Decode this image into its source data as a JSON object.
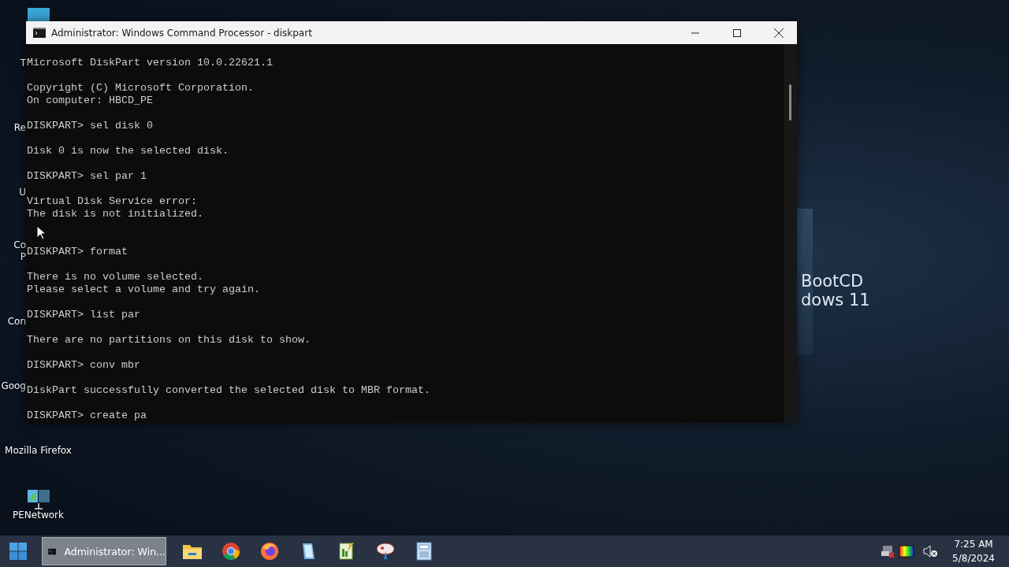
{
  "desktop": {
    "icons": [
      {
        "labels": [
          "T"
        ],
        "kind": "hidden"
      },
      {
        "labels": [
          "Re"
        ],
        "kind": "hidden"
      },
      {
        "labels": [
          "U"
        ],
        "kind": "hidden"
      },
      {
        "labels": [
          "Co",
          "P"
        ],
        "kind": "hidden"
      },
      {
        "labels": [
          "Con"
        ],
        "kind": "hidden"
      },
      {
        "labels": [
          "Goog"
        ],
        "kind": "hidden"
      },
      {
        "labels": [
          "Mozilla Firefox"
        ],
        "kind": "plain"
      },
      {
        "labels": [
          "PENetwork"
        ],
        "kind": "network"
      }
    ],
    "wallpaper_text": [
      "BootCD",
      "dows 11"
    ]
  },
  "window": {
    "title": "Administrator: Windows Command Processor - diskpart",
    "console": [
      {
        "lines": [
          "Microsoft DiskPart version 10.0.22621.1"
        ]
      },
      {
        "lines": [
          "Copyright (C) Microsoft Corporation.",
          "On computer: HBCD_PE"
        ]
      },
      {
        "lines": [
          "DISKPART> sel disk 0"
        ]
      },
      {
        "lines": [
          "Disk 0 is now the selected disk."
        ]
      },
      {
        "lines": [
          "DISKPART> sel par 1"
        ]
      },
      {
        "lines": [
          "Virtual Disk Service error:",
          "The disk is not initialized."
        ],
        "extra_blank": true
      },
      {
        "lines": [
          "DISKPART> format"
        ]
      },
      {
        "lines": [
          "There is no volume selected.",
          "Please select a volume and try again."
        ]
      },
      {
        "lines": [
          "DISKPART> list par"
        ]
      },
      {
        "lines": [
          "There are no partitions on this disk to show."
        ]
      },
      {
        "lines": [
          "DISKPART> conv mbr"
        ]
      },
      {
        "lines": [
          "DiskPart successfully converted the selected disk to MBR format."
        ]
      },
      {
        "lines": [
          "DISKPART> create pa"
        ]
      }
    ]
  },
  "taskbar": {
    "active_task": {
      "label": "Administrator: Win...",
      "selected": true
    },
    "apps": [
      {
        "kind": "folder"
      },
      {
        "kind": "chrome"
      },
      {
        "kind": "firefox"
      },
      {
        "kind": "notepad"
      },
      {
        "kind": "editor"
      },
      {
        "kind": "paint"
      },
      {
        "kind": "calculator"
      }
    ],
    "time": "7:25 AM",
    "date": "5/8/2024"
  }
}
